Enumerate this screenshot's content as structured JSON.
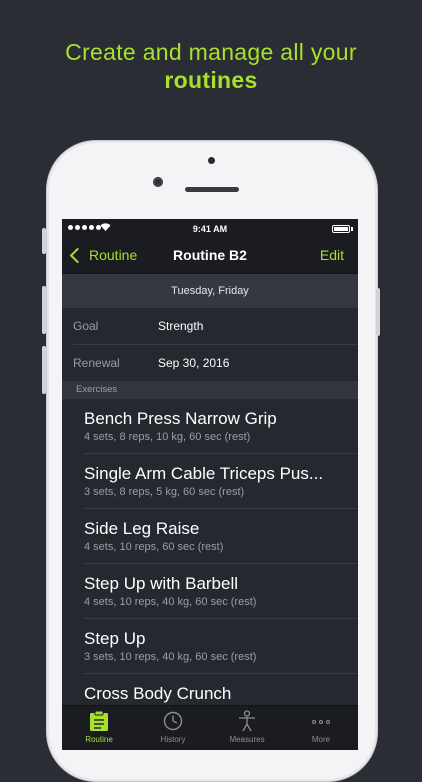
{
  "headline": {
    "line1": "Create and manage all your",
    "line2": "routines"
  },
  "status": {
    "time": "9:41 AM",
    "wifi": "wifi-icon"
  },
  "nav": {
    "back_label": "Routine",
    "title": "Routine B2",
    "edit_label": "Edit"
  },
  "days": "Tuesday, Friday",
  "info": [
    {
      "label": "Goal",
      "value": "Strength"
    },
    {
      "label": "Renewal",
      "value": "Sep 30, 2016"
    }
  ],
  "section": "Exercises",
  "exercises": [
    {
      "name": "Bench Press Narrow Grip",
      "detail": "4 sets, 8 reps, 10 kg, 60 sec (rest)"
    },
    {
      "name": "Single Arm Cable Triceps Pus...",
      "detail": "3 sets, 8 reps, 5 kg, 60 sec (rest)"
    },
    {
      "name": "Side Leg Raise",
      "detail": "4 sets, 10 reps, 60 sec (rest)"
    },
    {
      "name": "Step Up with Barbell",
      "detail": "4 sets, 10 reps, 40 kg, 60 sec (rest)"
    },
    {
      "name": "Step Up",
      "detail": "3 sets, 10 reps, 40 kg, 60 sec (rest)"
    },
    {
      "name": "Cross Body Crunch",
      "detail": ""
    }
  ],
  "tabs": [
    {
      "label": "Routine",
      "icon": "clipboard-icon",
      "active": true
    },
    {
      "label": "History",
      "icon": "clock-icon",
      "active": false
    },
    {
      "label": "Measures",
      "icon": "body-icon",
      "active": false
    },
    {
      "label": "More",
      "icon": "ellipsis-icon",
      "active": false
    }
  ],
  "colors": {
    "accent": "#a8e02c",
    "background": "#2b2d35",
    "screen": "#262830",
    "bar": "#1b1c21"
  }
}
